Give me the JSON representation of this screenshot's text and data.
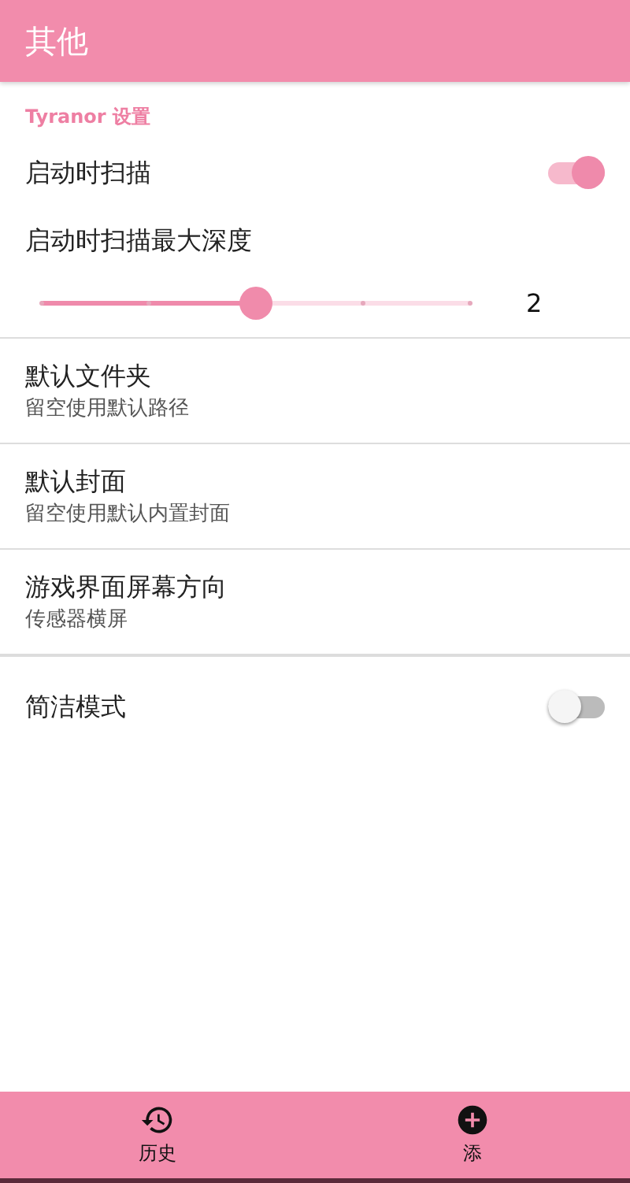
{
  "app_bar": {
    "title": "其他"
  },
  "section": {
    "title": "Tyranor 设置"
  },
  "settings": [
    {
      "kind": "switch",
      "title": "启动时扫描",
      "on": true
    },
    {
      "kind": "slider",
      "title": "启动时扫描最大深度",
      "level": 0.5,
      "reading": "2"
    },
    {
      "kind": "text",
      "title": "默认文件夹",
      "summary": "留空使用默认路径"
    },
    {
      "kind": "text",
      "title": "默认封面",
      "summary": "留空使用默认内置封面"
    },
    {
      "kind": "text",
      "title": "游戏界面屏幕方向",
      "summary": "传感器横屏"
    },
    {
      "kind": "switch",
      "title": "简洁模式",
      "on": false
    }
  ],
  "bottom_nav": [
    {
      "kind": "history",
      "label": "历史"
    },
    {
      "kind": "add",
      "label": "添"
    }
  ]
}
